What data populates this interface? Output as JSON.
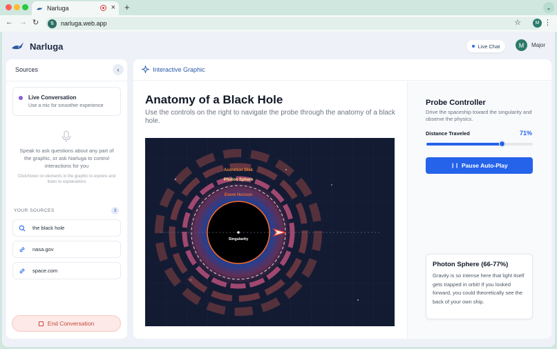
{
  "browser": {
    "tab_title": "Narluga",
    "url": "narluga.web.app",
    "profile_initial": "M"
  },
  "app": {
    "brand": "Narluga",
    "live_chat_label": "Live Chat",
    "user_initial": "M",
    "user_name": "Major"
  },
  "sidebar": {
    "title": "Sources",
    "live_card": {
      "title": "Live Conversation",
      "subtitle": "Use a mic for smoother experience"
    },
    "speak_text": "Speak to ask questions about any part of the graphic, or ask Narluga to control interactions for you",
    "hint_text": "Click/hover on elements in the graphic to explore and listen to explanations",
    "sources_label": "YOUR SOURCES",
    "sources_count": "3",
    "sources": [
      {
        "label": "the black hole",
        "icon": "search-icon"
      },
      {
        "label": "nasa.gov",
        "icon": "link-icon"
      },
      {
        "label": "space.com",
        "icon": "link-icon"
      }
    ],
    "end_button": "End Conversation"
  },
  "main": {
    "header": "Interactive Graphic",
    "title": "Anatomy of a Black Hole",
    "description": "Use the controls on the right to navigate the probe through the anatomy of a black hole.",
    "viz_labels": {
      "accretion": "Accretion Disk",
      "photon": "Photon Sphere",
      "horizon": "Event Horizon",
      "singularity": "Singularity"
    },
    "colors": {
      "accretion": "#f08a3c",
      "photon": "#fde68a",
      "horizon": "#f26b2a",
      "accent": "#2563eb"
    }
  },
  "controller": {
    "title": "Probe Controller",
    "description": "Drive the spaceship toward the singularity and observe the physics.",
    "distance_label": "Distance Traveled",
    "distance_value": "71%",
    "distance_fraction": 0.71,
    "pause_button": "Pause Auto-Play",
    "info_title": "Photon Sphere (66-77%)",
    "info_body": "Gravity is so intense here that light itself gets trapped in orbit! If you looked forward, you could theoretically see the back of your own ship."
  }
}
